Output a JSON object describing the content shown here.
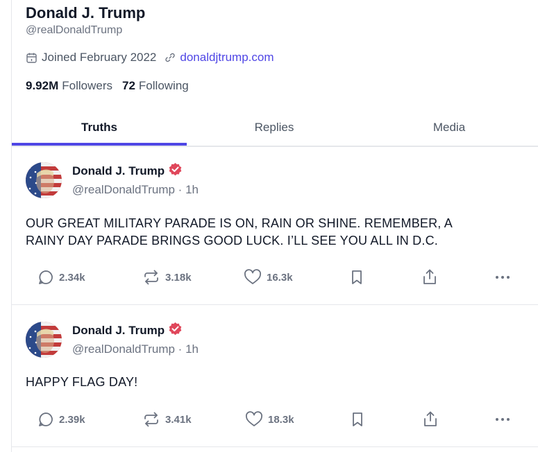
{
  "profile": {
    "name": "Donald J. Trump",
    "handle": "@realDonaldTrump",
    "joined": "Joined February 2022",
    "website": "donaldjtrump.com",
    "followers_count": "9.92M",
    "followers_label": "Followers",
    "following_count": "72",
    "following_label": "Following"
  },
  "tabs": [
    {
      "label": "Truths",
      "active": true
    },
    {
      "label": "Replies",
      "active": false
    },
    {
      "label": "Media",
      "active": false
    }
  ],
  "posts": [
    {
      "author": "Donald J. Trump",
      "handle_time": "@realDonaldTrump · 1h",
      "text_line1": "OUR GREAT MILITARY PARADE IS ON, RAIN OR SHINE. REMEMBER, A",
      "text_line2": "RAINY DAY PARADE BRINGS GOOD LUCK. I’LL SEE YOU ALL IN D.C.",
      "replies": "2.34k",
      "retruths": "3.18k",
      "likes": "16.3k"
    },
    {
      "author": "Donald J. Trump",
      "handle_time": "@realDonaldTrump · 1h",
      "text_line1": "HAPPY FLAG DAY!",
      "replies": "2.39k",
      "retruths": "3.41k",
      "likes": "18.3k"
    }
  ],
  "colors": {
    "accent": "#4f46e5",
    "verified_badge": "#e0475b",
    "text_primary": "#111827",
    "text_secondary": "#6b7280"
  },
  "icons": {
    "calendar": "calendar-icon",
    "link": "link-icon",
    "verified": "verified-badge-icon",
    "reply": "reply-icon",
    "retruth": "retruth-icon",
    "like": "heart-icon",
    "bookmark": "bookmark-icon",
    "share": "share-icon",
    "more": "more-icon"
  }
}
